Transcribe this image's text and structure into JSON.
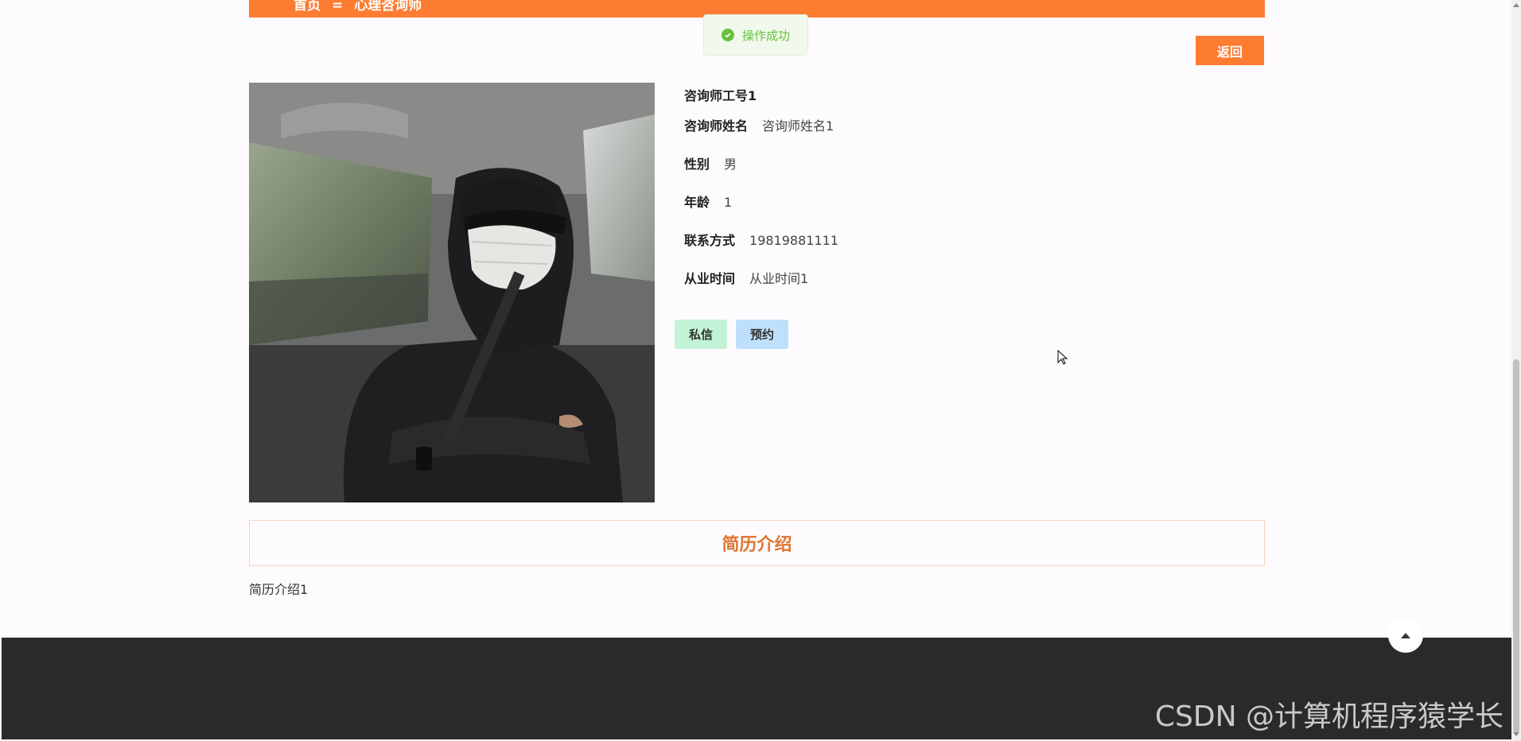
{
  "breadcrumb": {
    "home": "首页",
    "separator": "=",
    "current": "心理咨询师"
  },
  "toast": {
    "message": "操作成功",
    "icon": "check-circle-icon",
    "color": "#67c23a"
  },
  "actions": {
    "back_label": "返回"
  },
  "profile": {
    "title": "咨询师工号1",
    "fields": [
      {
        "label": "咨询师姓名",
        "value": "咨询师姓名1"
      },
      {
        "label": "性别",
        "value": "男"
      },
      {
        "label": "年龄",
        "value": "1"
      },
      {
        "label": "联系方式",
        "value": "19819881111"
      },
      {
        "label": "从业时间",
        "value": "从业时间1"
      }
    ],
    "message_label": "私信",
    "booking_label": "预约"
  },
  "resume": {
    "heading": "简历介绍",
    "content": "简历介绍1"
  },
  "footer": {
    "watermark": "CSDN @计算机程序猿学长"
  },
  "colors": {
    "accent": "#fe7c32",
    "footer": "#2a2a2a"
  }
}
